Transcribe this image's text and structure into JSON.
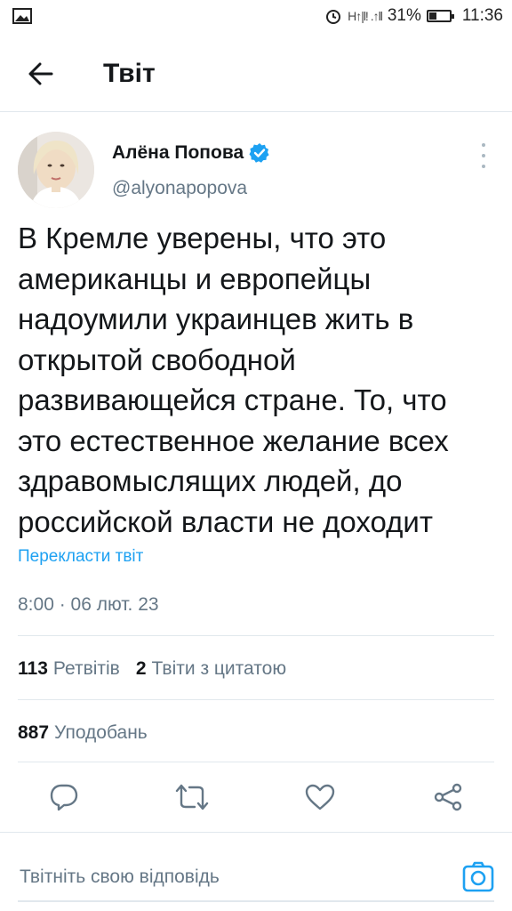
{
  "status_bar": {
    "signal_text": "H↑|l! .↑ll",
    "battery_percent": "31%",
    "time": "11:36",
    "icons": [
      "gallery-icon",
      "alarm-icon",
      "signal-icon",
      "battery-icon"
    ]
  },
  "header": {
    "title": "Твіт",
    "back_icon": "arrow-left-icon"
  },
  "tweet": {
    "author_name": "Алёна Попова",
    "verified": true,
    "handle": "@alyonapopova",
    "text": "В Кремле уверены, что это американцы и европейцы надоумили украинцев жить в открытой свободной развивающейся стране. То, что это естественное желание всех здравомыслящих людей, до российской власти не доходит",
    "translate_label": "Перекласти твіт",
    "timestamp": "8:00 · 06 лют. 23"
  },
  "stats": {
    "retweets_count": "113",
    "retweets_label": "Ретвітів",
    "quotes_count": "2",
    "quotes_label": "Твіти з цитатою",
    "likes_count": "887",
    "likes_label": "Уподобань"
  },
  "actions": [
    "reply-icon",
    "retweet-icon",
    "like-icon",
    "share-icon"
  ],
  "reply": {
    "placeholder": "Твітніть свою відповідь",
    "camera_icon": "camera-icon"
  },
  "colors": {
    "accent": "#1da1f2",
    "secondary_text": "#657786",
    "divider": "#e1e8ed",
    "primary_text": "#14171a"
  }
}
